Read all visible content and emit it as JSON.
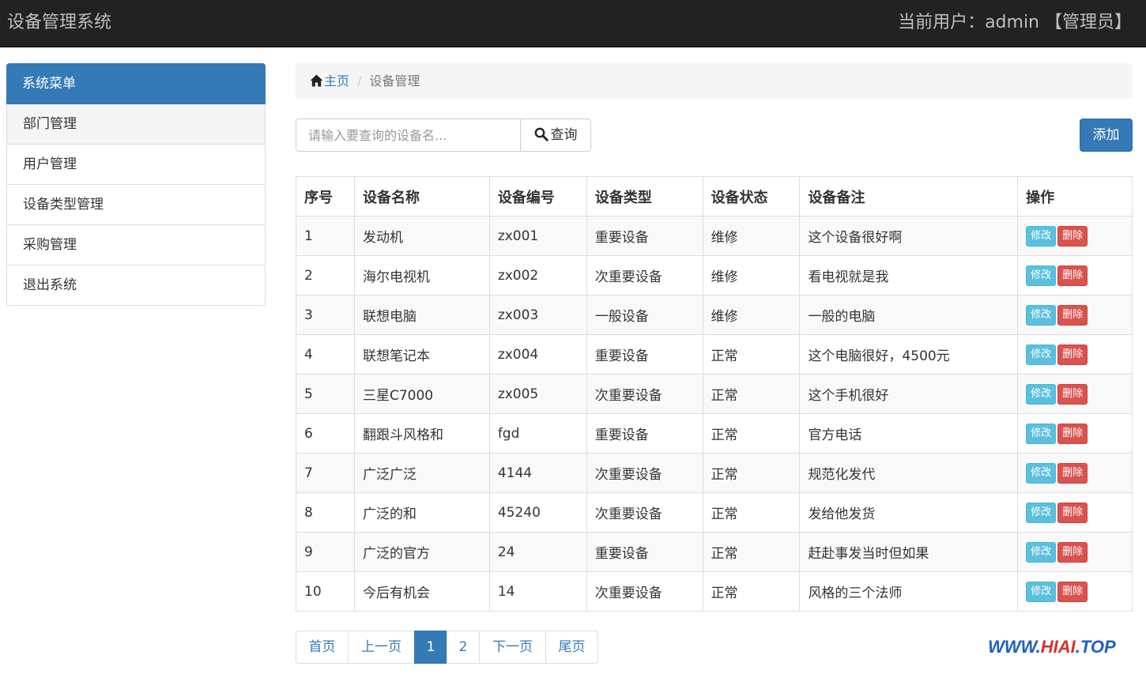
{
  "navbar": {
    "brand": "设备管理系统",
    "user_text": "当前用户：admin 【管理员】"
  },
  "sidebar": {
    "title": "系统菜单",
    "items": [
      {
        "label": "部门管理"
      },
      {
        "label": "用户管理"
      },
      {
        "label": "设备类型管理"
      },
      {
        "label": "采购管理"
      },
      {
        "label": "退出系统"
      }
    ]
  },
  "breadcrumb": {
    "home": "主页",
    "separator": "/",
    "current": "设备管理"
  },
  "search": {
    "placeholder": "请输入要查询的设备名...",
    "button_label": "查询"
  },
  "toolbar": {
    "add_label": "添加"
  },
  "table": {
    "headers": [
      "序号",
      "设备名称",
      "设备编号",
      "设备类型",
      "设备状态",
      "设备备注",
      "操作"
    ],
    "edit_label": "修改",
    "delete_label": "删除",
    "rows": [
      {
        "no": "1",
        "name": "发动机",
        "code": "zx001",
        "type": "重要设备",
        "status": "维修",
        "remark": "这个设备很好啊"
      },
      {
        "no": "2",
        "name": "海尔电视机",
        "code": "zx002",
        "type": "次重要设备",
        "status": "维修",
        "remark": "看电视就是我"
      },
      {
        "no": "3",
        "name": "联想电脑",
        "code": "zx003",
        "type": "一般设备",
        "status": "维修",
        "remark": "一般的电脑"
      },
      {
        "no": "4",
        "name": "联想笔记本",
        "code": "zx004",
        "type": "重要设备",
        "status": "正常",
        "remark": "这个电脑很好，4500元"
      },
      {
        "no": "5",
        "name": "三星C7000",
        "code": "zx005",
        "type": "次重要设备",
        "status": "正常",
        "remark": "这个手机很好"
      },
      {
        "no": "6",
        "name": "翻跟斗风格和",
        "code": "fgd",
        "type": "重要设备",
        "status": "正常",
        "remark": "官方电话"
      },
      {
        "no": "7",
        "name": "广泛广泛",
        "code": "4144",
        "type": "次重要设备",
        "status": "正常",
        "remark": "规范化发代"
      },
      {
        "no": "8",
        "name": "广泛的和",
        "code": "45240",
        "type": "次重要设备",
        "status": "正常",
        "remark": "发给他发货"
      },
      {
        "no": "9",
        "name": "广泛的官方",
        "code": "24",
        "type": "重要设备",
        "status": "正常",
        "remark": "赶赴事发当时但如果"
      },
      {
        "no": "10",
        "name": "今后有机会",
        "code": "14",
        "type": "次重要设备",
        "status": "正常",
        "remark": "风格的三个法师"
      }
    ]
  },
  "pagination": {
    "first": "首页",
    "prev": "上一页",
    "pages": [
      "1",
      "2"
    ],
    "current": "1",
    "next": "下一页",
    "last": "尾页"
  },
  "watermark": {
    "text_a": "WWW.",
    "text_b": "HIAI",
    "text_c": ".TOP"
  },
  "colors": {
    "primary": "#337ab7",
    "info": "#5bc0de",
    "danger": "#d9534f",
    "navbar": "#222222"
  }
}
